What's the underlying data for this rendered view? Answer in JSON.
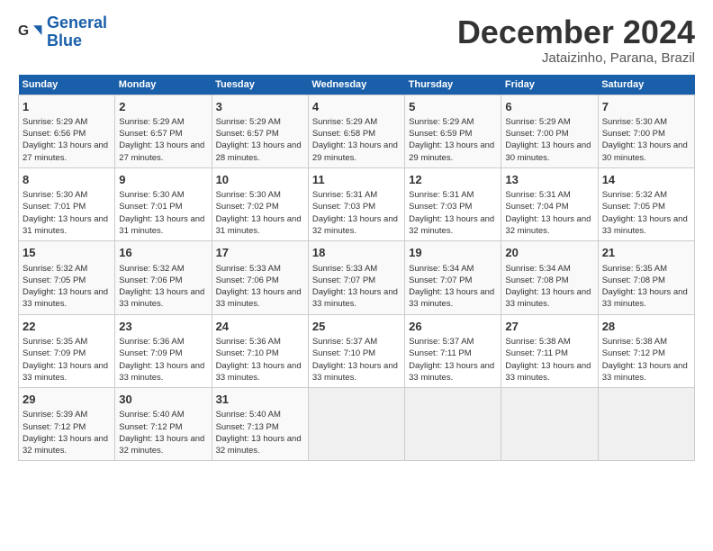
{
  "logo": {
    "line1": "General",
    "line2": "Blue"
  },
  "title": "December 2024",
  "location": "Jataizinho, Parana, Brazil",
  "days_of_week": [
    "Sunday",
    "Monday",
    "Tuesday",
    "Wednesday",
    "Thursday",
    "Friday",
    "Saturday"
  ],
  "weeks": [
    [
      {
        "day": "1",
        "rise": "Sunrise: 5:29 AM",
        "set": "Sunset: 6:56 PM",
        "daylight": "Daylight: 13 hours and 27 minutes."
      },
      {
        "day": "2",
        "rise": "Sunrise: 5:29 AM",
        "set": "Sunset: 6:57 PM",
        "daylight": "Daylight: 13 hours and 27 minutes."
      },
      {
        "day": "3",
        "rise": "Sunrise: 5:29 AM",
        "set": "Sunset: 6:57 PM",
        "daylight": "Daylight: 13 hours and 28 minutes."
      },
      {
        "day": "4",
        "rise": "Sunrise: 5:29 AM",
        "set": "Sunset: 6:58 PM",
        "daylight": "Daylight: 13 hours and 29 minutes."
      },
      {
        "day": "5",
        "rise": "Sunrise: 5:29 AM",
        "set": "Sunset: 6:59 PM",
        "daylight": "Daylight: 13 hours and 29 minutes."
      },
      {
        "day": "6",
        "rise": "Sunrise: 5:29 AM",
        "set": "Sunset: 7:00 PM",
        "daylight": "Daylight: 13 hours and 30 minutes."
      },
      {
        "day": "7",
        "rise": "Sunrise: 5:30 AM",
        "set": "Sunset: 7:00 PM",
        "daylight": "Daylight: 13 hours and 30 minutes."
      }
    ],
    [
      {
        "day": "8",
        "rise": "Sunrise: 5:30 AM",
        "set": "Sunset: 7:01 PM",
        "daylight": "Daylight: 13 hours and 31 minutes."
      },
      {
        "day": "9",
        "rise": "Sunrise: 5:30 AM",
        "set": "Sunset: 7:01 PM",
        "daylight": "Daylight: 13 hours and 31 minutes."
      },
      {
        "day": "10",
        "rise": "Sunrise: 5:30 AM",
        "set": "Sunset: 7:02 PM",
        "daylight": "Daylight: 13 hours and 31 minutes."
      },
      {
        "day": "11",
        "rise": "Sunrise: 5:31 AM",
        "set": "Sunset: 7:03 PM",
        "daylight": "Daylight: 13 hours and 32 minutes."
      },
      {
        "day": "12",
        "rise": "Sunrise: 5:31 AM",
        "set": "Sunset: 7:03 PM",
        "daylight": "Daylight: 13 hours and 32 minutes."
      },
      {
        "day": "13",
        "rise": "Sunrise: 5:31 AM",
        "set": "Sunset: 7:04 PM",
        "daylight": "Daylight: 13 hours and 32 minutes."
      },
      {
        "day": "14",
        "rise": "Sunrise: 5:32 AM",
        "set": "Sunset: 7:05 PM",
        "daylight": "Daylight: 13 hours and 33 minutes."
      }
    ],
    [
      {
        "day": "15",
        "rise": "Sunrise: 5:32 AM",
        "set": "Sunset: 7:05 PM",
        "daylight": "Daylight: 13 hours and 33 minutes."
      },
      {
        "day": "16",
        "rise": "Sunrise: 5:32 AM",
        "set": "Sunset: 7:06 PM",
        "daylight": "Daylight: 13 hours and 33 minutes."
      },
      {
        "day": "17",
        "rise": "Sunrise: 5:33 AM",
        "set": "Sunset: 7:06 PM",
        "daylight": "Daylight: 13 hours and 33 minutes."
      },
      {
        "day": "18",
        "rise": "Sunrise: 5:33 AM",
        "set": "Sunset: 7:07 PM",
        "daylight": "Daylight: 13 hours and 33 minutes."
      },
      {
        "day": "19",
        "rise": "Sunrise: 5:34 AM",
        "set": "Sunset: 7:07 PM",
        "daylight": "Daylight: 13 hours and 33 minutes."
      },
      {
        "day": "20",
        "rise": "Sunrise: 5:34 AM",
        "set": "Sunset: 7:08 PM",
        "daylight": "Daylight: 13 hours and 33 minutes."
      },
      {
        "day": "21",
        "rise": "Sunrise: 5:35 AM",
        "set": "Sunset: 7:08 PM",
        "daylight": "Daylight: 13 hours and 33 minutes."
      }
    ],
    [
      {
        "day": "22",
        "rise": "Sunrise: 5:35 AM",
        "set": "Sunset: 7:09 PM",
        "daylight": "Daylight: 13 hours and 33 minutes."
      },
      {
        "day": "23",
        "rise": "Sunrise: 5:36 AM",
        "set": "Sunset: 7:09 PM",
        "daylight": "Daylight: 13 hours and 33 minutes."
      },
      {
        "day": "24",
        "rise": "Sunrise: 5:36 AM",
        "set": "Sunset: 7:10 PM",
        "daylight": "Daylight: 13 hours and 33 minutes."
      },
      {
        "day": "25",
        "rise": "Sunrise: 5:37 AM",
        "set": "Sunset: 7:10 PM",
        "daylight": "Daylight: 13 hours and 33 minutes."
      },
      {
        "day": "26",
        "rise": "Sunrise: 5:37 AM",
        "set": "Sunset: 7:11 PM",
        "daylight": "Daylight: 13 hours and 33 minutes."
      },
      {
        "day": "27",
        "rise": "Sunrise: 5:38 AM",
        "set": "Sunset: 7:11 PM",
        "daylight": "Daylight: 13 hours and 33 minutes."
      },
      {
        "day": "28",
        "rise": "Sunrise: 5:38 AM",
        "set": "Sunset: 7:12 PM",
        "daylight": "Daylight: 13 hours and 33 minutes."
      }
    ],
    [
      {
        "day": "29",
        "rise": "Sunrise: 5:39 AM",
        "set": "Sunset: 7:12 PM",
        "daylight": "Daylight: 13 hours and 32 minutes."
      },
      {
        "day": "30",
        "rise": "Sunrise: 5:40 AM",
        "set": "Sunset: 7:12 PM",
        "daylight": "Daylight: 13 hours and 32 minutes."
      },
      {
        "day": "31",
        "rise": "Sunrise: 5:40 AM",
        "set": "Sunset: 7:13 PM",
        "daylight": "Daylight: 13 hours and 32 minutes."
      },
      null,
      null,
      null,
      null
    ]
  ]
}
